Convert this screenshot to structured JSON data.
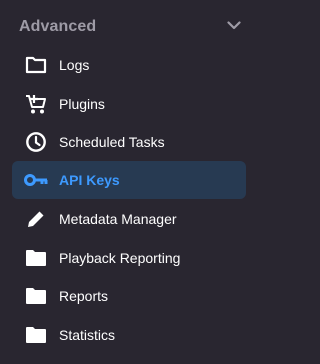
{
  "section": {
    "title": "Advanced",
    "collapse_icon": "chevron-down-icon"
  },
  "colors": {
    "background": "#292630",
    "section_title": "#9e9ba6",
    "active_background": "#273a52",
    "active_text": "#3d9aff",
    "text": "#ffffff"
  },
  "items": [
    {
      "label": "Logs",
      "icon": "folder-outline-icon",
      "active": false
    },
    {
      "label": "Plugins",
      "icon": "cart-plus-icon",
      "active": false
    },
    {
      "label": "Scheduled Tasks",
      "icon": "clock-icon",
      "active": false
    },
    {
      "label": "API Keys",
      "icon": "key-icon",
      "active": true
    },
    {
      "label": "Metadata Manager",
      "icon": "pencil-icon",
      "active": false
    },
    {
      "label": "Playback Reporting",
      "icon": "folder-icon",
      "active": false
    },
    {
      "label": "Reports",
      "icon": "folder-icon",
      "active": false
    },
    {
      "label": "Statistics",
      "icon": "folder-icon",
      "active": false
    }
  ]
}
